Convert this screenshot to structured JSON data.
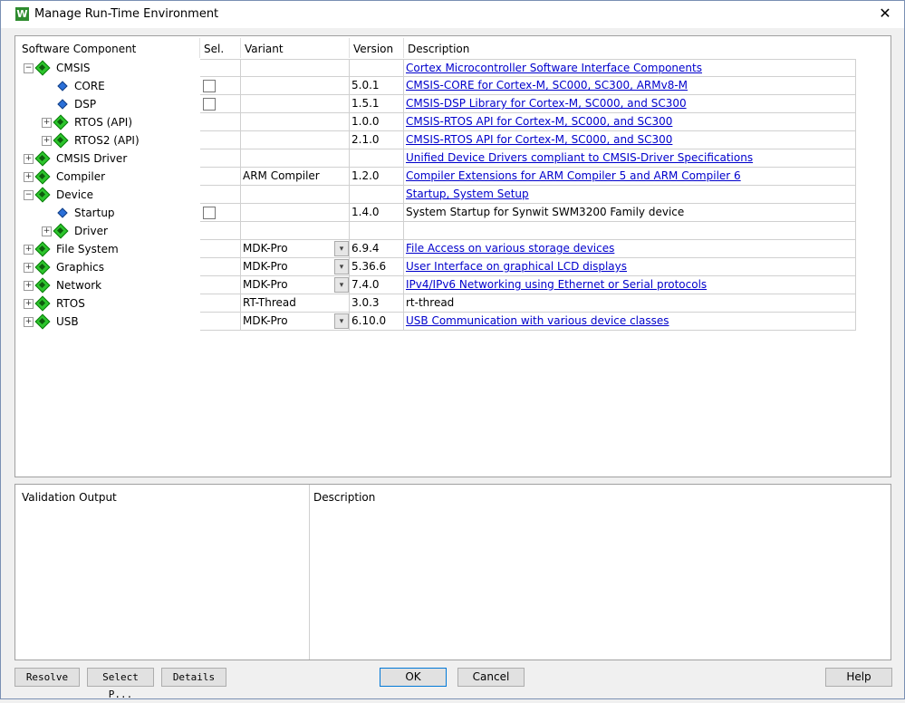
{
  "window": {
    "title": "Manage Run-Time Environment",
    "app_icon_letter": "W",
    "close_glyph": "✕"
  },
  "headers": {
    "component": "Software Component",
    "sel": "Sel.",
    "variant": "Variant",
    "version": "Version",
    "description": "Description"
  },
  "rows": [
    {
      "name": "CMSIS",
      "level": 0,
      "expander": "−",
      "icon": "green",
      "sel": "",
      "variant": "",
      "version": "",
      "desc": "Cortex Microcontroller Software Interface Components",
      "link": true
    },
    {
      "name": "CORE",
      "level": 1,
      "expander": "",
      "icon": "blue",
      "sel": "checkbox",
      "variant": "",
      "version": "5.0.1",
      "desc": "CMSIS-CORE for Cortex-M, SC000, SC300, ARMv8-M",
      "link": true
    },
    {
      "name": "DSP",
      "level": 1,
      "expander": "",
      "icon": "blue",
      "sel": "checkbox",
      "variant": "",
      "version": "1.5.1",
      "desc": "CMSIS-DSP Library for Cortex-M, SC000, and SC300",
      "link": true
    },
    {
      "name": "RTOS (API)",
      "level": 1,
      "expander": "+",
      "icon": "green",
      "sel": "",
      "variant": "",
      "version": "1.0.0",
      "desc": "CMSIS-RTOS API for Cortex-M, SC000, and SC300",
      "link": true
    },
    {
      "name": "RTOS2 (API)",
      "level": 1,
      "expander": "+",
      "icon": "green",
      "sel": "",
      "variant": "",
      "version": "2.1.0",
      "desc": "CMSIS-RTOS API for Cortex-M, SC000, and SC300",
      "link": true
    },
    {
      "name": "CMSIS Driver",
      "level": 0,
      "expander": "+",
      "icon": "green",
      "sel": "",
      "variant": "",
      "version": "",
      "desc": "Unified Device Drivers compliant to CMSIS-Driver Specifications",
      "link": true
    },
    {
      "name": "Compiler",
      "level": 0,
      "expander": "+",
      "icon": "green",
      "sel": "",
      "variant": "ARM Compiler",
      "version": "1.2.0",
      "desc": "Compiler Extensions for ARM Compiler 5 and ARM Compiler 6",
      "link": true
    },
    {
      "name": "Device",
      "level": 0,
      "expander": "−",
      "icon": "green",
      "sel": "",
      "variant": "",
      "version": "",
      "desc": "Startup, System Setup",
      "link": true
    },
    {
      "name": "Startup",
      "level": 1,
      "expander": "",
      "icon": "blue",
      "sel": "checkbox",
      "variant": "",
      "version": "1.4.0",
      "desc": "System Startup for Synwit SWM3200 Family device",
      "link": false
    },
    {
      "name": "Driver",
      "level": 1,
      "expander": "+",
      "icon": "green",
      "sel": "",
      "variant": "",
      "version": "",
      "desc": "",
      "link": false
    },
    {
      "name": "File System",
      "level": 0,
      "expander": "+",
      "icon": "green",
      "sel": "",
      "variant": "MDK-Pro",
      "dropdown": true,
      "version": "6.9.4",
      "desc": "File Access on various storage devices",
      "link": true
    },
    {
      "name": "Graphics",
      "level": 0,
      "expander": "+",
      "icon": "green",
      "sel": "",
      "variant": "MDK-Pro",
      "dropdown": true,
      "version": "5.36.6",
      "desc": "User Interface on graphical LCD displays",
      "link": true
    },
    {
      "name": "Network",
      "level": 0,
      "expander": "+",
      "icon": "green",
      "sel": "",
      "variant": "MDK-Pro",
      "dropdown": true,
      "version": "7.4.0",
      "desc": "IPv4/IPv6 Networking using Ethernet or Serial protocols",
      "link": true
    },
    {
      "name": "RTOS",
      "level": 0,
      "expander": "+",
      "icon": "green",
      "sel": "",
      "variant": "RT-Thread",
      "version": "3.0.3",
      "desc": "rt-thread",
      "link": false
    },
    {
      "name": "USB",
      "level": 0,
      "expander": "+",
      "icon": "green",
      "sel": "",
      "variant": "MDK-Pro",
      "dropdown": true,
      "version": "6.10.0",
      "desc": "USB Communication with various device classes",
      "link": true
    }
  ],
  "bottom": {
    "validation_header": "Validation Output",
    "description_header": "Description"
  },
  "buttons": {
    "resolve": "Resolve",
    "select_packs": "Select P...",
    "details": "Details",
    "ok": "OK",
    "cancel": "Cancel",
    "help": "Help"
  }
}
